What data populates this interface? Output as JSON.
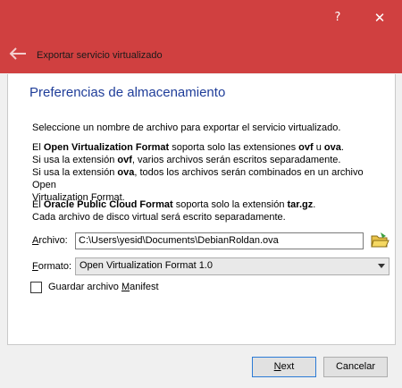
{
  "titlebar": {
    "help": "?",
    "close": "✕",
    "wizard_title": "Exportar servicio virtualizado"
  },
  "main": {
    "heading": "Preferencias de almacenamiento",
    "intro": "Seleccione un nombre de archivo para exportar el servicio virtualizado.",
    "ovf": {
      "l1_pre": "El ",
      "l1_b1": "Open Virtualization Format",
      "l1_mid": " soporta solo las extensiones ",
      "l1_b2": "ovf",
      "l1_u": " u ",
      "l1_b3": "ova",
      "l1_end": ".",
      "l2_pre": "Si usa la extensión ",
      "l2_b": "ovf",
      "l2_post": ", varios archivos serán escritos separadamente.",
      "l3_pre": "Si usa la extensión ",
      "l3_b": "ova",
      "l3_post": ", todos los archivos serán combinados en un archivo Open",
      "l4": "Virtualization Format."
    },
    "opc": {
      "l1_pre": "El ",
      "l1_b1": "Oracle Public Cloud Format",
      "l1_mid": " soporta solo la extensión ",
      "l1_b2": "tar.gz",
      "l1_end": ".",
      "l2": "Cada archivo de disco virtual será escrito separadamente."
    },
    "file_label_u": "A",
    "file_label_rest": "rchivo:",
    "file_value": "C:\\Users\\yesid\\Documents\\DebianRoldan.ova",
    "format_label_u": "F",
    "format_label_rest": "ormato:",
    "format_value": "Open Virtualization Format 1.0",
    "manifest_pre": "Guardar archivo ",
    "manifest_u": "M",
    "manifest_post": "anifest",
    "manifest_checked": false
  },
  "buttons": {
    "next_u": "N",
    "next_rest": "ext",
    "cancel": "Cancelar"
  },
  "colors": {
    "titlebar": "#d04040",
    "heading": "#1f3d99"
  }
}
